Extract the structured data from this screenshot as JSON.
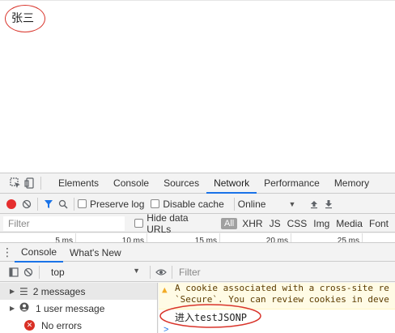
{
  "page": {
    "name_text": "张三"
  },
  "devtools": {
    "tabs": [
      "Elements",
      "Console",
      "Sources",
      "Network",
      "Performance",
      "Memory"
    ],
    "active_tab": "Network",
    "network_toolbar": {
      "preserve_log": "Preserve log",
      "disable_cache": "Disable cache",
      "throttle": "Online"
    },
    "filter": {
      "placeholder": "Filter",
      "hide_data_urls": "Hide data URLs",
      "types": [
        "All",
        "XHR",
        "JS",
        "CSS",
        "Img",
        "Media",
        "Font"
      ]
    },
    "timeline": [
      "5 ms",
      "10 ms",
      "15 ms",
      "20 ms",
      "25 ms"
    ],
    "drawer_tabs": [
      "Console",
      "What's New"
    ],
    "console_toolbar": {
      "context": "top",
      "filter_placeholder": "Filter"
    },
    "sidebar": [
      {
        "label": "2 messages",
        "selected": true
      },
      {
        "label": "1 user message",
        "selected": false
      },
      {
        "label": "No errors",
        "selected": false
      }
    ],
    "messages": {
      "warning_line1": "A cookie associated with a cross-site re",
      "warning_line2": "`Secure`. You can review cookies in deve",
      "log": "进入testJSONP",
      "prompt": ">"
    }
  },
  "colors": {
    "accent": "#1a73e8",
    "annotation": "#d9342b",
    "record": "#e52e2e"
  }
}
